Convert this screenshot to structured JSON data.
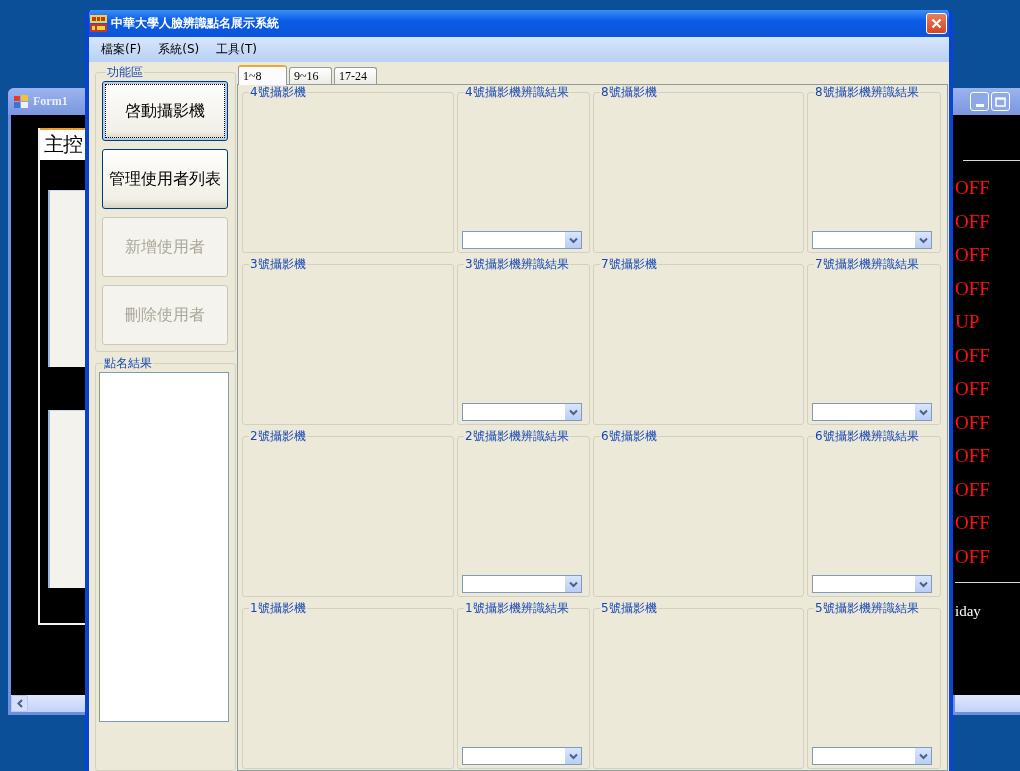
{
  "background_window": {
    "title": "Form1",
    "tab_label": "主控",
    "status_items": [
      {
        "text": "OFF"
      },
      {
        "text": "OFF"
      },
      {
        "text": "OFF"
      },
      {
        "text": "OFF"
      },
      {
        "text": "UP"
      },
      {
        "text": "OFF"
      },
      {
        "text": "OFF"
      },
      {
        "text": "OFF"
      },
      {
        "text": "OFF"
      },
      {
        "text": "OFF"
      },
      {
        "text": "OFF"
      },
      {
        "text": "OFF"
      }
    ],
    "footer_text": "iday"
  },
  "window": {
    "title": "中華大學人臉辨識點名展示系統"
  },
  "menu": [
    "檔案(F)",
    "系統(S)",
    "工具(T)"
  ],
  "function_panel": {
    "title": "功能區",
    "buttons": [
      {
        "label": "啓動攝影機",
        "disabled": false,
        "focused": true
      },
      {
        "label": "管理使用者列表",
        "disabled": false,
        "focused": false
      },
      {
        "label": "新增使用者",
        "disabled": true,
        "focused": false
      },
      {
        "label": "刪除使用者",
        "disabled": true,
        "focused": false
      }
    ]
  },
  "result_panel": {
    "title": "點名結果"
  },
  "tabs": [
    {
      "label": "1~8",
      "selected": true
    },
    {
      "label": "9~16",
      "selected": false
    },
    {
      "label": "17-24",
      "selected": false
    }
  ],
  "grid": [
    {
      "kind": "camera",
      "title": "4號攝影機"
    },
    {
      "kind": "result",
      "title": "4號攝影機辨識結果"
    },
    {
      "kind": "camera",
      "title": "8號攝影機"
    },
    {
      "kind": "result",
      "title": "8號攝影機辨識結果"
    },
    {
      "kind": "camera",
      "title": "3號攝影機"
    },
    {
      "kind": "result",
      "title": "3號攝影機辨識結果"
    },
    {
      "kind": "camera",
      "title": "7號攝影機"
    },
    {
      "kind": "result",
      "title": "7號攝影機辨識結果"
    },
    {
      "kind": "camera",
      "title": "2號攝影機"
    },
    {
      "kind": "result",
      "title": "2號攝影機辨識結果"
    },
    {
      "kind": "camera",
      "title": "6號攝影機"
    },
    {
      "kind": "result",
      "title": "6號攝影機辨識結果"
    },
    {
      "kind": "camera",
      "title": "1號攝影機"
    },
    {
      "kind": "result",
      "title": "1號攝影機辨識結果"
    },
    {
      "kind": "camera",
      "title": "5號攝影機"
    },
    {
      "kind": "result",
      "title": "5號攝影機辨識結果"
    }
  ]
}
